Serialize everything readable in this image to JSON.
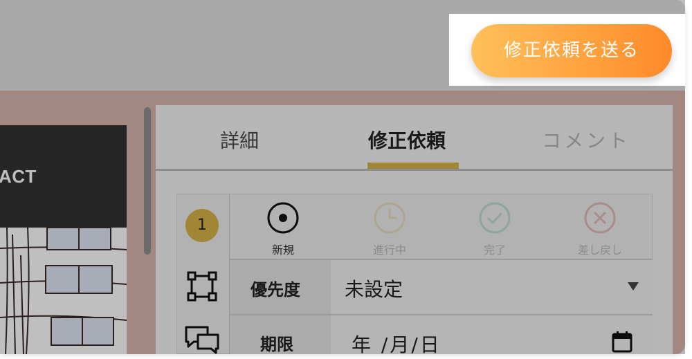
{
  "header": {
    "send_button_label": "修正依頼を送る"
  },
  "preview": {
    "banner_text": "ACT"
  },
  "tabs": [
    {
      "label": "詳細"
    },
    {
      "label": "修正依頼"
    },
    {
      "label": "コメント"
    }
  ],
  "request": {
    "number": "1",
    "statuses": [
      {
        "label": "新規",
        "icon": "radio-selected-icon"
      },
      {
        "label": "進行中",
        "icon": "clock-icon"
      },
      {
        "label": "完了",
        "icon": "check-circle-icon"
      },
      {
        "label": "差し戻し",
        "icon": "x-circle-icon"
      }
    ],
    "priority": {
      "label": "優先度",
      "value": "未設定"
    },
    "deadline": {
      "label": "期限",
      "value": "年 /月/日"
    }
  },
  "colors": {
    "accent": "#d7b349",
    "button_start": "#ffc05a",
    "button_end": "#ff8a2a"
  }
}
